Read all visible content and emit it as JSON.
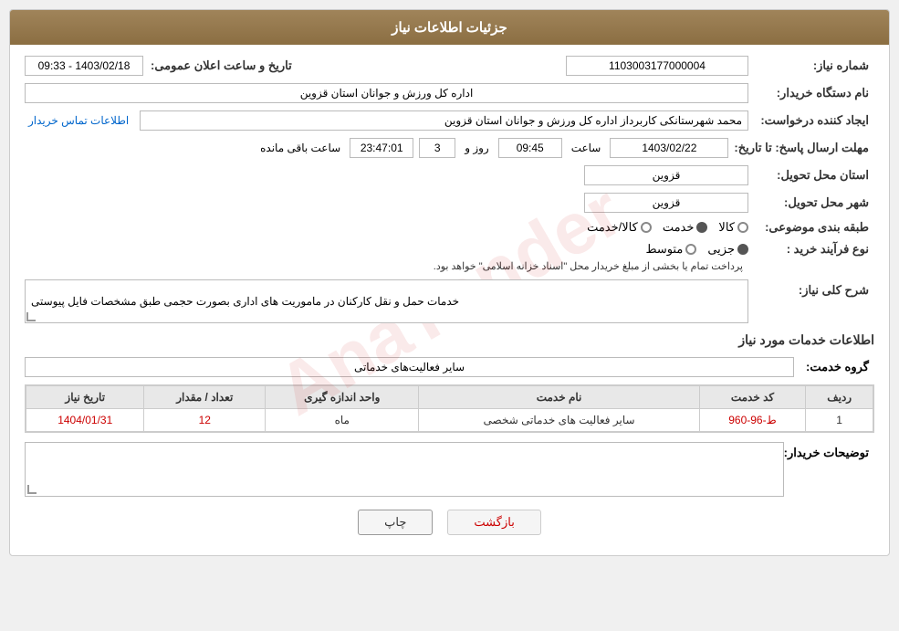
{
  "header": {
    "title": "جزئیات اطلاعات نیاز"
  },
  "fields": {
    "need_number_label": "شماره نیاز:",
    "need_number_value": "1103003177000004",
    "announce_datetime_label": "تاریخ و ساعت اعلان عمومی:",
    "announce_datetime_value": "1403/02/18 - 09:33",
    "buyer_org_label": "نام دستگاه خریدار:",
    "buyer_org_value": "اداره کل ورزش و جوانان استان قزوین",
    "creator_label": "ایجاد کننده درخواست:",
    "creator_value": "محمد شهرستانکی کاربرداز اداره کل ورزش و جوانان استان قزوین",
    "contact_link": "اطلاعات تماس خریدار",
    "deadline_label": "مهلت ارسال پاسخ: تا تاریخ:",
    "deadline_date": "1403/02/22",
    "deadline_time_label": "ساعت",
    "deadline_time": "09:45",
    "deadline_days_label": "روز و",
    "deadline_days": "3",
    "deadline_remaining_label": "ساعت باقی مانده",
    "deadline_remaining": "23:47:01",
    "delivery_province_label": "استان محل تحویل:",
    "delivery_province_value": "قزوین",
    "delivery_city_label": "شهر محل تحویل:",
    "delivery_city_value": "قزوین",
    "subject_type_label": "طبقه بندی موضوعی:",
    "subject_type_options": [
      "کالا",
      "خدمت",
      "کالا/خدمت"
    ],
    "subject_type_selected": "خدمت",
    "purchase_type_label": "نوع فرآیند خرید :",
    "purchase_type_options": [
      "جزیی",
      "متوسط"
    ],
    "purchase_type_selected": "جزیی",
    "purchase_type_note": "پرداخت تمام یا بخشی از مبلغ خریدار محل \"اسناد خزانه اسلامی\" خواهد بود.",
    "need_description_label": "شرح کلی نیاز:",
    "need_description_value": "خدمات حمل و نقل کارکنان در ماموریت های اداری بصورت حجمی طبق مشخصات فایل پیوستی",
    "services_section_title": "اطلاعات خدمات مورد نیاز",
    "service_group_label": "گروه خدمت:",
    "service_group_value": "سایر فعالیت‌های خدماتی",
    "table": {
      "columns": [
        "ردیف",
        "کد خدمت",
        "نام خدمت",
        "واحد اندازه گیری",
        "تعداد / مقدار",
        "تاریخ نیاز"
      ],
      "rows": [
        {
          "row": "1",
          "code": "ط-96-960",
          "name": "سایر فعالیت های خدماتی شخصی",
          "unit": "ماه",
          "qty": "12",
          "date": "1404/01/31"
        }
      ]
    },
    "buyer_desc_label": "توضیحات خریدار:",
    "buyer_desc_value": ""
  },
  "buttons": {
    "print_label": "چاپ",
    "back_label": "بازگشت"
  }
}
